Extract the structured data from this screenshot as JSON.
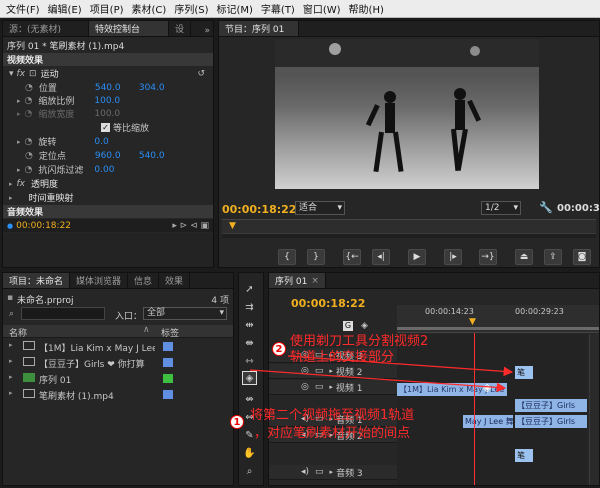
{
  "menu": [
    "文件(F)",
    "编辑(E)",
    "项目(P)",
    "素材(C)",
    "序列(S)",
    "标记(M)",
    "字幕(T)",
    "窗口(W)",
    "帮助(H)"
  ],
  "source_tabs": {
    "source": "源：(无素材)",
    "effect_controls": "特效控制台",
    "more": "设"
  },
  "ec": {
    "clip_path": "序列 01 * 笔刷素材 (1).mp4",
    "video_effects": "视频效果",
    "motion": "运动",
    "position_label": "位置",
    "position_x": "540.0",
    "position_y": "304.0",
    "scale_label": "缩放比例",
    "scale_val": "100.0",
    "scale_width_label": "缩放宽度",
    "uniform_label": "等比缩放",
    "rotation_label": "旋转",
    "rotation_val": "0.0",
    "anchor_label": "定位点",
    "anchor_x": "960.0",
    "anchor_y": "540.0",
    "flicker_label": "抗闪烁过滤",
    "flicker_val": "0.00",
    "opacity_label": "透明度",
    "time_remap_label": "时间重映射",
    "audio_effects": "音频效果",
    "timecode": "00:00:18:22"
  },
  "program": {
    "tab": "节目：序列 01",
    "timecode": "00:00:18:22",
    "fit": "适合",
    "ratio": "1/2",
    "end_tc": "00:00:3"
  },
  "project": {
    "tabs": [
      "项目：未命名",
      "媒体浏览器",
      "信息",
      "效果"
    ],
    "name": "未命名.prproj",
    "count": "4 项",
    "inlet_label": "入口：",
    "inlet_value": "全部",
    "col_name": "名称",
    "col_label": "标签",
    "items": [
      "【1M】Lia Kim x May J Lee",
      "【豆豆子】Girls ❤ 你打算",
      "序列 01",
      "笔刷素材 (1).mp4"
    ]
  },
  "timeline": {
    "tab": "序列 01",
    "timecode": "00:00:18:22",
    "ruler": [
      "00:00:14:23",
      "00:00:29:23"
    ],
    "tracks": [
      "视频 3",
      "视频 2",
      "视频 1",
      "音频 1",
      "音频 2",
      "音频 3"
    ],
    "clip_v2": "【1M】Lia Kim x May J Lee",
    "clip_v1_a": "【豆豆子】Girls",
    "clip_v1_b": "May J Lee 舞",
    "clip_v1_c": "【豆豆子】Girls",
    "clip_brush": "笔"
  },
  "annot": {
    "n1": "1",
    "n2": "2",
    "text1a": "将第二个视频拖至视频1轨道",
    "text1b": "，对应笔刷素材开始的间点",
    "text2a": "使用剃刀工具分割视频2",
    "text2b": "轨道上的交接部分"
  },
  "colors": {
    "accent": "#2a8ff7",
    "timecode": "#f0b020",
    "annotation": "#ff2a2a"
  }
}
